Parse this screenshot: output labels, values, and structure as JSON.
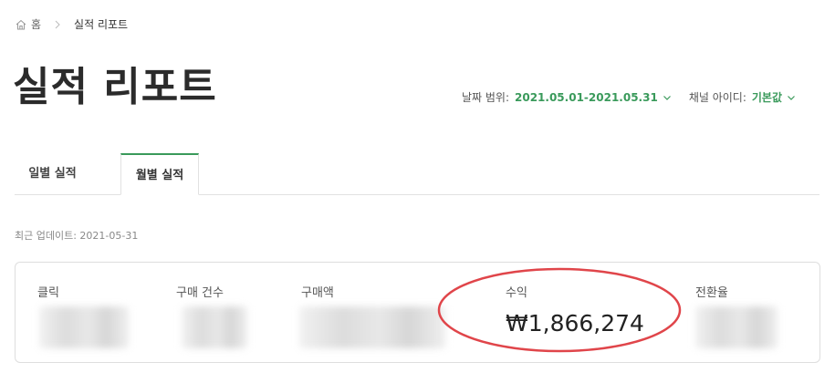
{
  "breadcrumb": {
    "home": "홈",
    "current": "실적 리포트"
  },
  "page_title": "실적 리포트",
  "filters": {
    "date_label": "날짜 범위:",
    "date_value": "2021.05.01-2021.05.31",
    "channel_label": "채널 아이디:",
    "channel_value": "기본값"
  },
  "tabs": [
    {
      "label": "일별 실적",
      "active": false
    },
    {
      "label": "월별 실적",
      "active": true
    }
  ],
  "last_updated": "최근 업데이트: 2021-05-31",
  "metrics": {
    "clicks": {
      "label": "클릭"
    },
    "purchase_count": {
      "label": "구매 건수"
    },
    "purchase_amount": {
      "label": "구매액"
    },
    "revenue": {
      "label": "수익",
      "value": "₩1,866,274"
    },
    "conversion_rate": {
      "label": "전환율"
    }
  },
  "colors": {
    "accent": "#3a9a5b",
    "highlight_ring": "#e0454a"
  }
}
